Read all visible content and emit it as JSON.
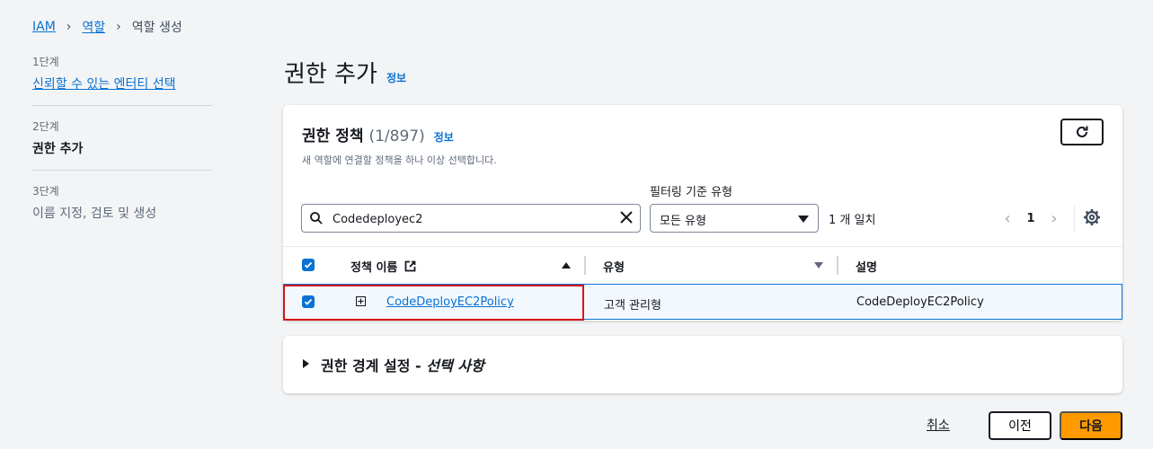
{
  "breadcrumb": {
    "items": [
      "IAM",
      "역할",
      "역할 생성"
    ]
  },
  "steps": [
    {
      "num": "1단계",
      "title": "신뢰할 수 있는 엔터티 선택"
    },
    {
      "num": "2단계",
      "title": "권한 추가"
    },
    {
      "num": "3단계",
      "title": "이름 지정, 검토 및 생성"
    }
  ],
  "page": {
    "title": "권한 추가",
    "info": "정보"
  },
  "policies": {
    "title": "권한 정책",
    "count": "(1/897)",
    "info": "정보",
    "description": "새 역할에 연결할 정책을 하나 이상 선택합니다.",
    "filter_label": "필터링 기준 유형",
    "search_value": "Codedeployec2",
    "filter_value": "모든 유형",
    "match_text": "1 개 일치",
    "current_page": "1",
    "columns": {
      "name": "정책 이름",
      "type": "유형",
      "description": "설명"
    },
    "rows": [
      {
        "name": "CodeDeployEC2Policy",
        "type": "고객 관리형",
        "description": "CodeDeployEC2Policy"
      }
    ]
  },
  "boundary": {
    "title": "권한 경계 설정 -",
    "optional": "선택 사항"
  },
  "footer": {
    "cancel": "취소",
    "previous": "이전",
    "next": "다음"
  },
  "colors": {
    "accent": "#0972d3",
    "primary_button": "#ff9900",
    "highlight": "#d91515"
  }
}
